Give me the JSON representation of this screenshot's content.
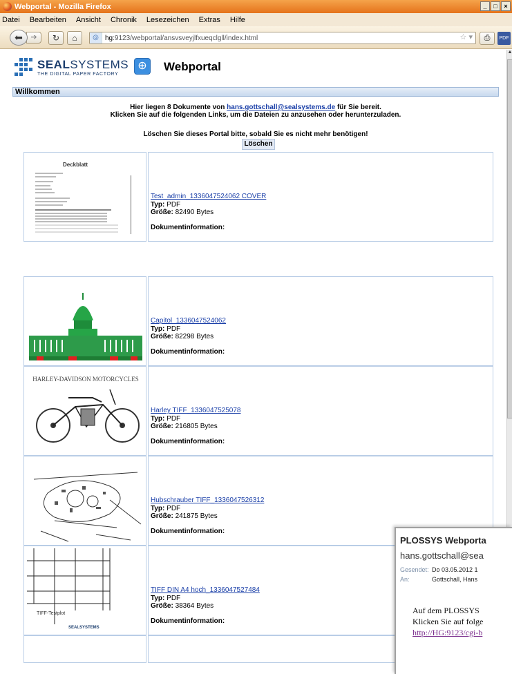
{
  "window": {
    "title": "Webportal - Mozilla Firefox",
    "controls": [
      "_",
      "□",
      "×"
    ]
  },
  "menu": [
    "Datei",
    "Bearbeiten",
    "Ansicht",
    "Chronik",
    "Lesezeichen",
    "Extras",
    "Hilfe"
  ],
  "toolbar": {
    "url_host": "hg",
    "url_rest": ":9123/webportal/ansvsveyjlfxueqclgll/index.html",
    "pdf_label": "PDF"
  },
  "header": {
    "brand_bold": "SEAL",
    "brand_light": "SYSTEMS",
    "tagline": "THE DIGITAL PAPER FACTORY",
    "title": "Webportal"
  },
  "welcome": "Willkommen",
  "intro": {
    "line1_pre": "Hier liegen 8 Dokumente von ",
    "email": "hans.gottschall@sealsystems.de",
    "line1_post": " für Sie bereit.",
    "line2": "Klicken Sie auf die folgenden Links, um die Dateien zu anzusehen oder herunterzuladen.",
    "line3": "Löschen Sie dieses Portal bitte, sobald Sie es nicht mehr benötigen!",
    "delete_label": "Löschen"
  },
  "labels": {
    "type": "Typ:",
    "size": "Größe:",
    "docinfo": "Dokumentinformation:"
  },
  "documents": [
    {
      "name": "Test_admin_1336047524062 COVER",
      "type": "PDF",
      "size": "82490 Bytes"
    },
    {
      "name": "Capitol_1336047524062",
      "type": "PDF",
      "size": "82298 Bytes"
    },
    {
      "name": "Harley TIFF_1336047525078",
      "type": "PDF",
      "size": "216805 Bytes"
    },
    {
      "name": "Hubschrauber TIFF_1336047526312",
      "type": "PDF",
      "size": "241875 Bytes"
    },
    {
      "name": "TIFF DIN A4 hoch_1336047527484",
      "type": "PDF",
      "size": "38364 Bytes"
    }
  ],
  "thumb_texts": {
    "cover_title": "Deckblatt",
    "tiff_label": "TIFF-Testplot",
    "tiff_brand": "SEALSYSTEMS",
    "harley_banner": "HARLEY-DAVIDSON MOTORCYCLES"
  },
  "email": {
    "subject": "PLOSSYS Webporta",
    "from": "hans.gottschall@sea",
    "sent_label": "Gesendet:",
    "sent_value": "Do 03.05.2012 1",
    "to_label": "An:",
    "to_value": "Gottschall, Hans",
    "body1": "Auf dem PLOSSYS",
    "body2": "Klicken Sie auf folge",
    "link": "http://HG:9123/cgi-b"
  }
}
